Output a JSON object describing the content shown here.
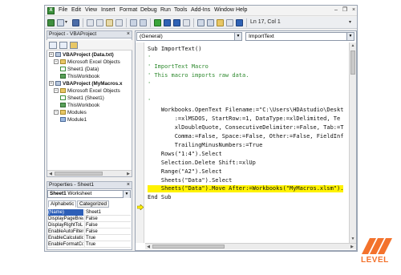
{
  "menu": [
    "File",
    "Edit",
    "View",
    "Insert",
    "Format",
    "Debug",
    "Run",
    "Tools",
    "Add-Ins",
    "Window",
    "Help"
  ],
  "toolbar": {
    "position": "Ln 17, Col 1"
  },
  "project": {
    "title": "Project - VBAProject",
    "close": "×",
    "tree": [
      {
        "exp": "−",
        "icon": "project-icon",
        "label": "VBAProject (Data.txt)",
        "bold": true
      },
      {
        "exp": "−",
        "icon": "folder-icon",
        "label": "Microsoft Excel Objects",
        "bold": false
      },
      {
        "exp": "",
        "icon": "sheet-icon",
        "label": "Sheet1 (Data)",
        "bold": false
      },
      {
        "exp": "",
        "icon": "workbook-icon",
        "label": "ThisWorkbook",
        "bold": false
      },
      {
        "exp": "−",
        "icon": "project-icon",
        "label": "VBAProject (MyMacros.x",
        "bold": true
      },
      {
        "exp": "−",
        "icon": "folder-icon",
        "label": "Microsoft Excel Objects",
        "bold": false
      },
      {
        "exp": "",
        "icon": "sheet-icon",
        "label": "Sheet1 (Sheet1)",
        "bold": false
      },
      {
        "exp": "",
        "icon": "workbook-icon",
        "label": "ThisWorkbook",
        "bold": false
      },
      {
        "exp": "−",
        "icon": "folder-icon",
        "label": "Modules",
        "bold": false
      },
      {
        "exp": "",
        "icon": "module-icon",
        "label": "Module1",
        "bold": false
      }
    ]
  },
  "properties": {
    "title": "Properties - Sheet1",
    "close": "×",
    "object_name": "Sheet1",
    "object_type": "Worksheet",
    "tabs": [
      "Alphabetic",
      "Categorized"
    ],
    "rows": [
      {
        "name": "(Name)",
        "value": "Sheet1"
      },
      {
        "name": "DisplayPageBrea",
        "value": "False"
      },
      {
        "name": "DisplayRightToL",
        "value": "False"
      },
      {
        "name": "EnableAutoFilter",
        "value": "False"
      },
      {
        "name": "EnableCalculatio",
        "value": "True"
      },
      {
        "name": "EnableFormatCo",
        "value": "True"
      }
    ]
  },
  "code": {
    "object_combo": "(General)",
    "proc_combo": "ImportText",
    "lines": [
      {
        "text": "Sub ImportText()",
        "type": "code"
      },
      {
        "text": "'",
        "type": "comment"
      },
      {
        "text": "' ImportText Macro",
        "type": "comment"
      },
      {
        "text": "' This macro imports raw data.",
        "type": "comment"
      },
      {
        "text": "'",
        "type": "comment"
      },
      {
        "text": "",
        "type": "code"
      },
      {
        "text": "'",
        "type": "comment"
      },
      {
        "text": "    Workbooks.OpenText Filename:=\"C:\\Users\\HDAstudio\\Deskt",
        "type": "code"
      },
      {
        "text": "        :=xlMSDOS, StartRow:=1, DataType:=xlDelimited, Te",
        "type": "code"
      },
      {
        "text": "        xlDoubleQuote, ConsecutiveDelimiter:=False, Tab:=T",
        "type": "code"
      },
      {
        "text": "        Comma:=False, Space:=False, Other:=False, FieldInf",
        "type": "code"
      },
      {
        "text": "        TrailingMinusNumbers:=True",
        "type": "code"
      },
      {
        "text": "    Rows(\"1:4\").Select",
        "type": "code"
      },
      {
        "text": "    Selection.Delete Shift:=xlUp",
        "type": "code"
      },
      {
        "text": "    Range(\"A2\").Select",
        "type": "code"
      },
      {
        "text": "    Sheets(\"Data\").Select",
        "type": "code"
      },
      {
        "text": "    Sheets(\"Data\").Move After:=Workbooks(\"MyMacros.xlsm\").",
        "type": "highlight"
      },
      {
        "text": "End Sub",
        "type": "code"
      }
    ]
  },
  "logo": {
    "text": "LEVEL"
  },
  "colors": {
    "highlight": "#fff200",
    "comment": "#2f8a2f",
    "logo": "#f3722c"
  }
}
